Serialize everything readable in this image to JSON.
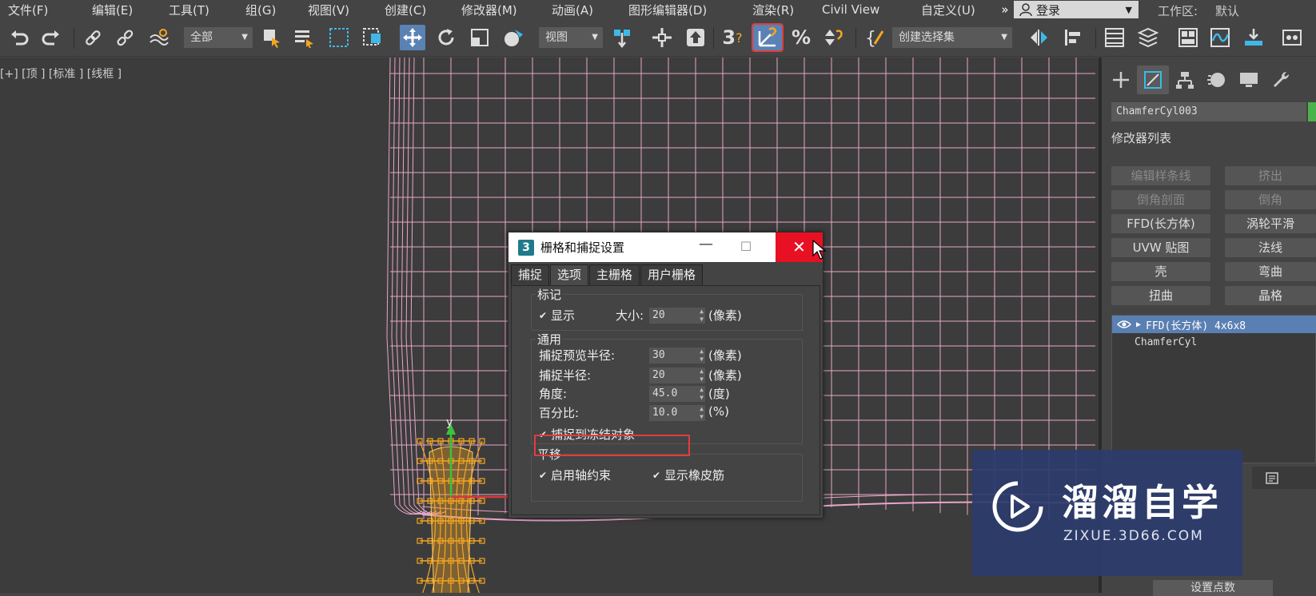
{
  "menu": {
    "items": [
      "文件(F)",
      "编辑(E)",
      "工具(T)",
      "组(G)",
      "视图(V)",
      "创建(C)",
      "修改器(M)",
      "动画(A)",
      "图形编辑器(D)",
      "渲染(R)",
      "Civil View",
      "自定义(U)"
    ],
    "overflow": "»",
    "login": "登录",
    "workspace_label": "工作区:",
    "workspace_value": "默认"
  },
  "toolbar": {
    "selection_filter": "全部",
    "ref_coord": "视图",
    "named_selection": "创建选择集",
    "snap_toggle_text": "3",
    "percent_snap": "%"
  },
  "viewport": {
    "label": "[+] [顶 ] [标准 ] [线框 ]",
    "axis_y": "y"
  },
  "command_panel": {
    "object_name": "ChamferCyl003",
    "object_color": "#4bb34b",
    "modifier_list_label": "修改器列表",
    "modifier_buttons": [
      {
        "label": "编辑样条线",
        "enabled": false
      },
      {
        "label": "挤出",
        "enabled": false
      },
      {
        "label": "倒角剖面",
        "enabled": false
      },
      {
        "label": "倒角",
        "enabled": false
      },
      {
        "label": "FFD(长方体)",
        "enabled": true
      },
      {
        "label": "涡轮平滑",
        "enabled": true
      },
      {
        "label": "UVW 贴图",
        "enabled": true
      },
      {
        "label": "法线",
        "enabled": true
      },
      {
        "label": "壳",
        "enabled": true
      },
      {
        "label": "弯曲",
        "enabled": true
      },
      {
        "label": "扭曲",
        "enabled": true
      },
      {
        "label": "晶格",
        "enabled": true
      }
    ],
    "stack": [
      {
        "label": "FFD(长方体) 4x6x8",
        "selected": true
      },
      {
        "label": "ChamferCyl",
        "selected": false
      }
    ],
    "rollout_button": "设置点数"
  },
  "dialog": {
    "icon": "3",
    "title": "栅格和捕捉设置",
    "tabs": [
      {
        "label": "捕捉",
        "active": false
      },
      {
        "label": "选项",
        "active": true
      },
      {
        "label": "主栅格",
        "active": false
      },
      {
        "label": "用户栅格",
        "active": false
      }
    ],
    "markers": {
      "title": "标记",
      "display_label": "显示",
      "display_checked": true,
      "size_label": "大小:",
      "size_value": "20",
      "size_unit": "(像素)"
    },
    "general": {
      "title": "通用",
      "preview_radius_label": "捕捉预览半径:",
      "preview_radius_value": "30",
      "preview_radius_unit": "(像素)",
      "snap_radius_label": "捕捉半径:",
      "snap_radius_value": "20",
      "snap_radius_unit": "(像素)",
      "angle_label": "角度:",
      "angle_value": "45.0",
      "angle_unit": "(度)",
      "percent_label": "百分比:",
      "percent_value": "10.0",
      "percent_unit": "(%)",
      "snap_frozen_label": "捕捉到冻结对象",
      "snap_frozen_checked": true
    },
    "translation": {
      "title": "平移",
      "axis_constraint_label": "启用轴约束",
      "axis_constraint_checked": true,
      "rubber_band_label": "显示橡皮筋",
      "rubber_band_checked": true
    }
  },
  "watermark": {
    "title": "溜溜自学",
    "url": "ZIXUE.3D66.COM"
  },
  "colors": {
    "highlight_red": "#e23c3c",
    "wire_pink": "#e8a6c8",
    "selected_orange": "#f5a623",
    "close_red": "#e81123"
  }
}
